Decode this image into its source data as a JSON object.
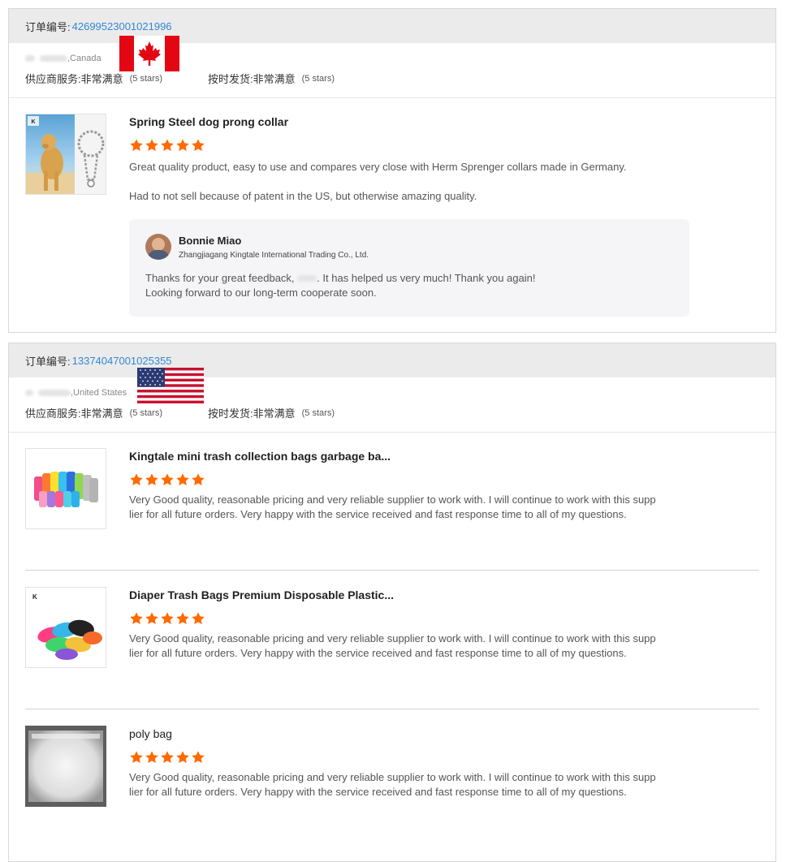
{
  "orders": [
    {
      "label": "订单编号:",
      "number": "42699523001021996",
      "country": ",Canada",
      "supplier_label": "供应商服务:",
      "supplier_value": "非常满意",
      "supplier_stars": "(5 stars)",
      "shipping_label": "按时发货:",
      "shipping_value": "非常满意",
      "shipping_stars": "(5 stars)",
      "items": [
        {
          "title": "Spring Steel dog prong collar",
          "rating": 5,
          "review_line1": "Great quality product, easy to use and compares very close with Herm Sprenger collars made in Germany.",
          "review_line2": "Had to not sell because of patent in the US, but otherwise amazing quality."
        }
      ],
      "reply": {
        "name": "Bonnie Miao",
        "company": "Zhangjiagang Kingtale International Trading Co., Ltd.",
        "text_a": "Thanks for your great feedback,",
        "text_b": ". It has helped us very much! Thank you again!",
        "text_c": "Looking forward to our long-term cooperate soon."
      }
    },
    {
      "label": "订单编号:",
      "number": "13374047001025355",
      "country": ",United States",
      "supplier_label": "供应商服务:",
      "supplier_value": "非常满意",
      "supplier_stars": "(5 stars)",
      "shipping_label": "按时发货:",
      "shipping_value": "非常满意",
      "shipping_stars": "(5 stars)",
      "items": [
        {
          "title": "Kingtale mini trash collection bags garbage ba...",
          "rating": 5,
          "review": "Very Good quality, reasonable pricing and very reliable supplier to work with. I will continue to work with this supplier for all future orders. Very happy with the service received and fast response time to all of my questions."
        },
        {
          "title": "Diaper Trash Bags Premium Disposable Plastic...",
          "rating": 5,
          "review": "Very Good quality, reasonable pricing and very reliable supplier to work with. I will continue to work with this supplier for all future orders. Very happy with the service received and fast response time to all of my questions."
        },
        {
          "title": "poly bag",
          "rating": 5,
          "review": "Very Good quality, reasonable pricing and very reliable supplier to work with. I will continue to work with this supplier for all future orders. Very happy with the service received and fast response time to all of my questions."
        }
      ]
    }
  ],
  "logo_text": "Kingtale",
  "colors": {
    "star": "#ff6a00",
    "link": "#2f88d8",
    "header_bg": "#ebebeb"
  },
  "icons": {
    "star": "star-icon",
    "flag_ca": "canada-flag-icon",
    "flag_us": "us-flag-icon"
  }
}
